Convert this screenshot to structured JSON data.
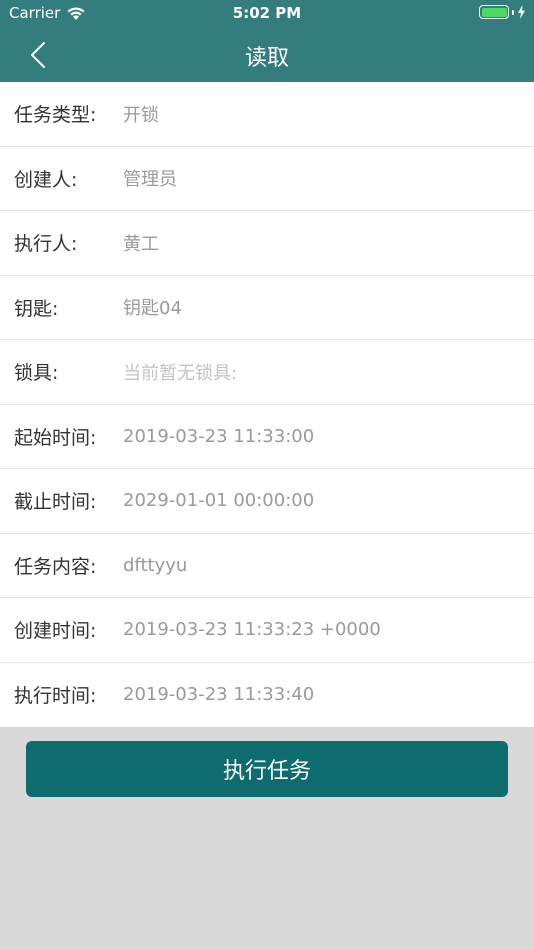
{
  "status_bar": {
    "carrier": "Carrier",
    "time": "5:02 PM",
    "battery_level": 1.0,
    "icons": [
      "wifi-icon",
      "battery-icon",
      "charging-bolt-icon"
    ]
  },
  "nav": {
    "title": "读取",
    "back_icon": "chevron-left-icon"
  },
  "fields": [
    {
      "label": "任务类型:",
      "value": "开锁"
    },
    {
      "label": "创建人:",
      "value": "管理员"
    },
    {
      "label": "执行人:",
      "value": "黄工"
    },
    {
      "label": "钥匙:",
      "value": "钥匙04"
    },
    {
      "label": "锁具:",
      "value": "当前暂无锁具:"
    },
    {
      "label": "起始时间:",
      "value": "2019-03-23 11:33:00"
    },
    {
      "label": "截止时间:",
      "value": "2029-01-01 00:00:00"
    },
    {
      "label": "任务内容:",
      "value": "dfttyyu"
    },
    {
      "label": "创建时间:",
      "value": "2019-03-23 11:33:23 +0000"
    },
    {
      "label": "执行时间:",
      "value": "2019-03-23 11:33:40"
    }
  ],
  "action": {
    "label": "执行任务"
  },
  "colors": {
    "header": "#347d7e",
    "button": "#0e6b6e",
    "background": "#d9d9d9",
    "battery": "#4cd964"
  }
}
